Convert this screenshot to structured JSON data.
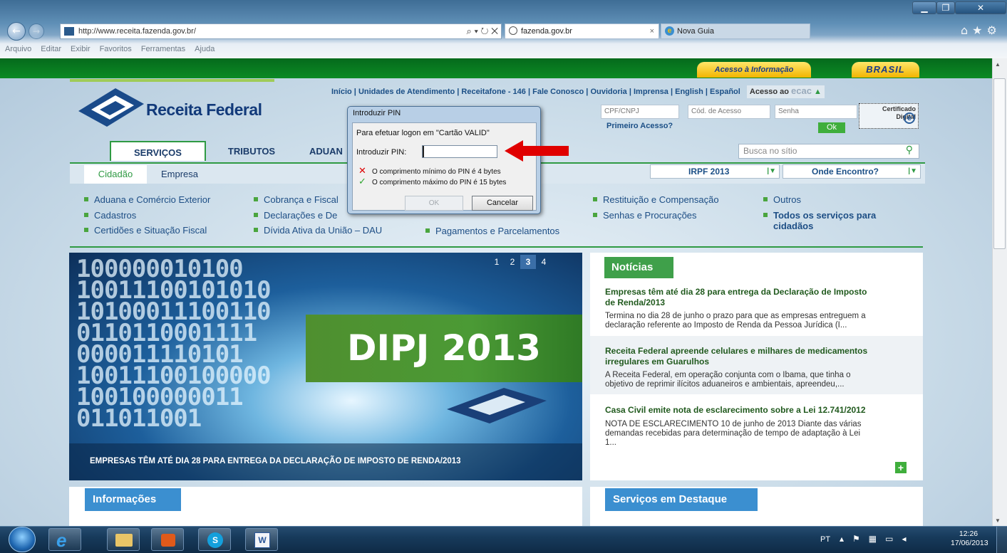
{
  "browser": {
    "url": "http://www.receita.fazenda.gov.br/",
    "search_controls": "⌕ ▾ ↻ ✕",
    "tabs": [
      {
        "label": "fazenda.gov.br",
        "close": "×"
      },
      {
        "label": "Nova Guia"
      }
    ],
    "menu": [
      "Arquivo",
      "Editar",
      "Exibir",
      "Favoritos",
      "Ferramentas",
      "Ajuda"
    ]
  },
  "site": {
    "access_info": "Acesso à Informação",
    "brasil": "BRASIL",
    "top_nav": [
      "Início",
      "Unidades de Atendimento",
      "Receitafone - 146",
      "Fale Conosco",
      "Ouvidoria",
      "Imprensa",
      "English",
      "Español"
    ],
    "access_label": "Acesso ao",
    "ecac": "ecac",
    "logo": "Receita Federal",
    "login": {
      "cpf_placeholder": "CPF/CNPJ",
      "code_placeholder": "Cód. de Acesso",
      "password_placeholder": "Senha",
      "first_access": "Primeiro Acesso?",
      "ok": "Ok",
      "cert_line1": "Certificado",
      "cert_line2": "Digital"
    },
    "main_tabs": [
      "SERVIÇOS",
      "TRIBUTOS",
      "ADUAN"
    ],
    "search_placeholder": "Busca no sítio",
    "sub_tabs": [
      "Cidadão",
      "Empresa"
    ],
    "drop_irpf": "IRPF 2013",
    "drop_onde": "Onde Encontro?",
    "links_col1": [
      "Aduana e Comércio Exterior",
      "Cadastros",
      "Certidões e Situação Fiscal"
    ],
    "links_col2": [
      "Cobrança e Fiscal",
      "Declarações e De",
      "Dívida Ativa da União – DAU"
    ],
    "link_col3": "Pagamentos e Parcelamentos",
    "links_col4": [
      "Restituição e Compensação",
      "Senhas e Procurações"
    ],
    "links_col5": [
      "Outros"
    ],
    "all_services_1": "Todos os serviços para",
    "all_services_2": "cidadãos",
    "banner": {
      "pages": [
        "1",
        "2",
        "3",
        "4"
      ],
      "headline": "DIPJ 2013",
      "caption": "EMPRESAS TÊM ATÉ DIA 28 PARA ENTREGA DA DECLARAÇÃO DE IMPOSTO DE RENDA/2013",
      "binary_rows": [
        "100000010100",
        "10011100101010",
        "10100011100110",
        "0110110001111",
        "000011110101",
        "10011100100000",
        "100100000011",
        "011011001"
      ]
    },
    "news": {
      "title": "Notícias",
      "items": [
        {
          "title_1": "Empresas têm até dia 28 para entrega da Declaração de Imposto",
          "title_2": "de Renda/2013",
          "body_1": "Termina no dia 28 de junho o prazo para que as empresas entreguem a",
          "body_2": "declaração referente ao Imposto de Renda da Pessoa Jurídica (I..."
        },
        {
          "title_1": "Receita Federal apreende celulares e milhares de medicamentos",
          "title_2": "irregulares em Guarulhos",
          "body_1": "A Receita Federal, em operação conjunta com o Ibama, que tinha o",
          "body_2": "objetivo de reprimir ilícitos aduaneiros e ambientais, apreendeu,..."
        },
        {
          "title_1": "Casa Civil emite nota de esclarecimento sobre a Lei 12.741/2012",
          "body_1": "NOTA DE ESCLARECIMENTO 10 de junho de 2013 Diante das várias",
          "body_2": "demandas recebidas para determinação de tempo de adaptação à Lei",
          "body_3": "1..."
        }
      ],
      "more": "+"
    },
    "info_title": "Informações",
    "services_title": "Serviços em Destaque"
  },
  "dialog": {
    "title": "Introduzir PIN",
    "subtitle": "Para efetuar logon em \"Cartão VALID\"",
    "pin_label": "Introduzir PIN:",
    "pin_value": "",
    "rule_min": "O comprimento mínimo do PIN é 4 bytes",
    "rule_max": "O comprimento máximo do PIN é 15 bytes",
    "ok": "OK",
    "cancel": "Cancelar"
  },
  "taskbar": {
    "language": "PT",
    "time": "12:26",
    "date": "17/06/2013"
  },
  "colors": {
    "site_green": "#0c8a24",
    "accent_blue": "#3b8fd0",
    "arrow_red": "#e00000"
  }
}
